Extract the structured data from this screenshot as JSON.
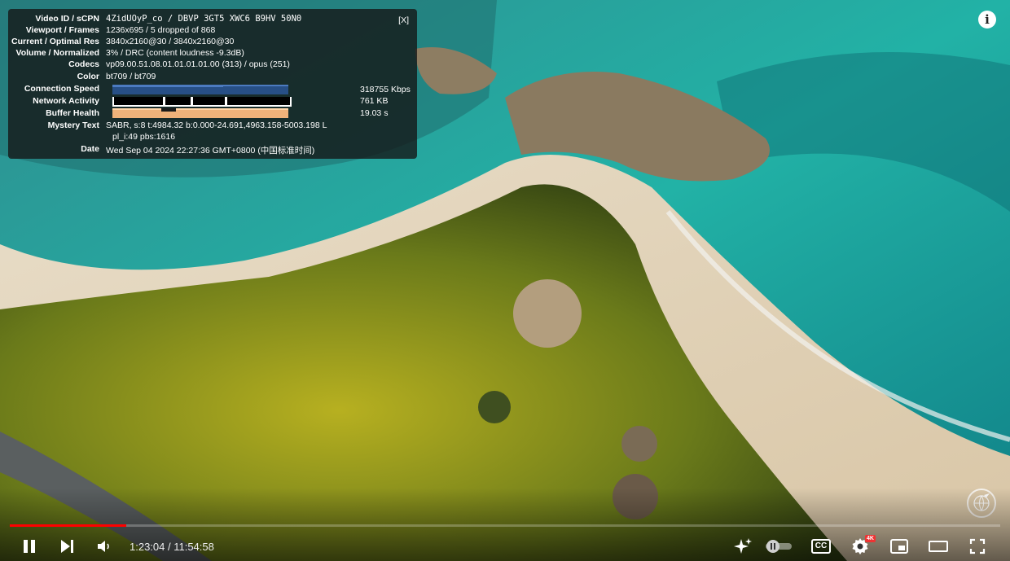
{
  "stats": {
    "close_label": "[X]",
    "rows": [
      {
        "label": "Video ID / sCPN",
        "value": "4ZidUOyP_co  /  DBVP 3GT5 XWC6 B9HV 50N0"
      },
      {
        "label": "Viewport / Frames",
        "value": "1236x695 / 5 dropped of 868"
      },
      {
        "label": "Current / Optimal Res",
        "value": "3840x2160@30 / 3840x2160@30"
      },
      {
        "label": "Volume / Normalized",
        "value": "3% / DRC (content loudness -9.3dB)"
      },
      {
        "label": "Codecs",
        "value": "vp09.00.51.08.01.01.01.01.00 (313) / opus (251)"
      },
      {
        "label": "Color",
        "value": "bt709 / bt709"
      },
      {
        "label": "Connection Speed",
        "value": "318755 Kbps"
      },
      {
        "label": "Network Activity",
        "value": "761 KB"
      },
      {
        "label": "Buffer Health",
        "value": "19.03 s"
      },
      {
        "label": "Mystery Text",
        "value": "SABR, s:8 t:4984.32 b:0.000-24.691,4963.158-5003.198 L",
        "value2": "pl_i:49 pbs:1616"
      },
      {
        "label": "Date",
        "value": "Wed Sep 04 2024 22:27:36 GMT+0800 (中国标准时间)"
      }
    ]
  },
  "player": {
    "time_display": "1:23:04 / 11:54:58",
    "progress_fraction": 0.118,
    "quality_badge": "4K",
    "colors": {
      "progress": "#ff0000",
      "badge": "#e33333"
    },
    "icons": [
      "info-icon",
      "pause-icon",
      "next-icon",
      "volume-icon",
      "sparkle-icon",
      "autoplay-toggle-icon",
      "captions-icon",
      "settings-icon",
      "miniplayer-icon",
      "theater-icon",
      "fullscreen-icon"
    ],
    "captions_label": "CC"
  }
}
